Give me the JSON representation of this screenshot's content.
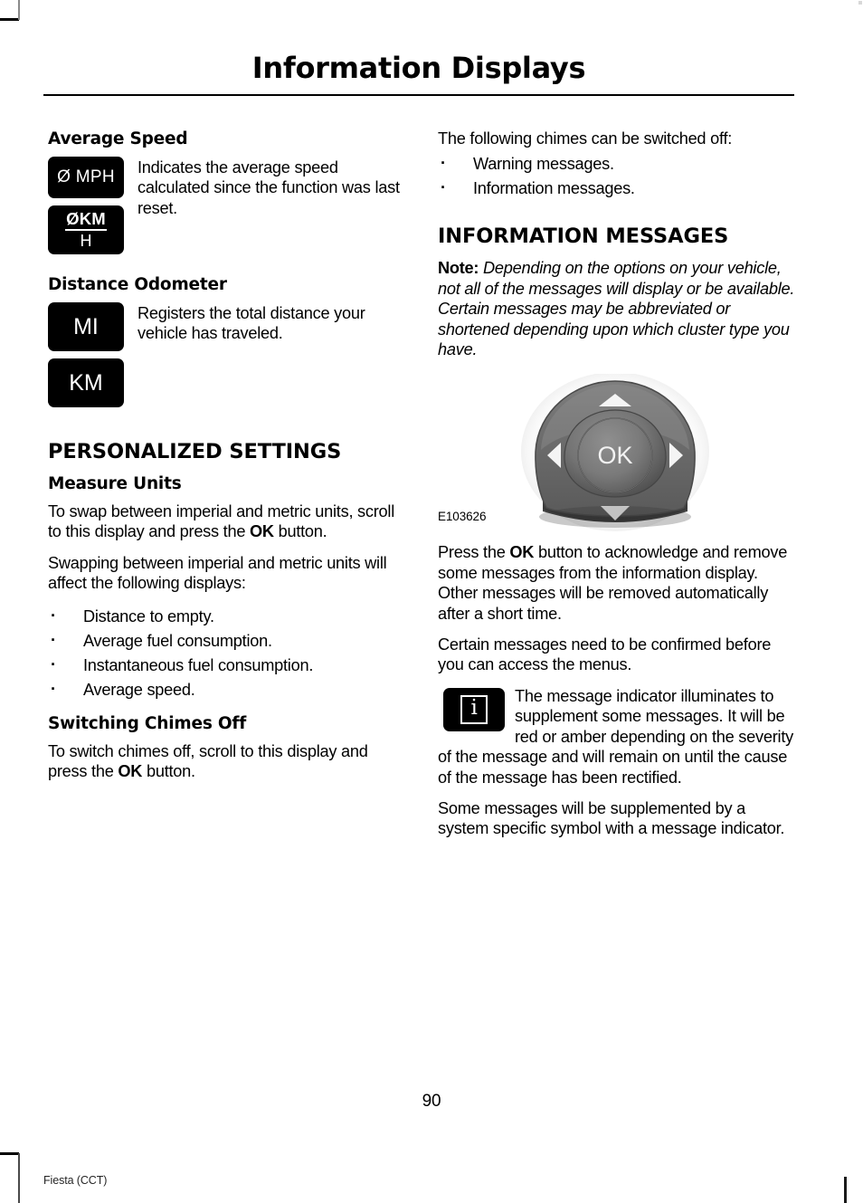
{
  "page": {
    "title": "Information Displays",
    "page_number": "90",
    "footer_left": "Fiesta (CCT)"
  },
  "left_column": {
    "average_speed": {
      "heading": "Average Speed",
      "icons": [
        {
          "name": "avg-speed-mph-icon",
          "label": "Ø MPH"
        },
        {
          "name": "avg-speed-kmh-icon",
          "numerator": "ØKM",
          "denominator": "H"
        }
      ],
      "description": "Indicates the average speed calculated since the function was last reset."
    },
    "distance_odometer": {
      "heading": "Distance Odometer",
      "icons": [
        {
          "name": "odometer-mi-icon",
          "label": "MI"
        },
        {
          "name": "odometer-km-icon",
          "label": "KM"
        }
      ],
      "description": "Registers the total distance your vehicle has traveled."
    },
    "personalized_settings": {
      "heading": "PERSONALIZED SETTINGS",
      "measure_units": {
        "heading": "Measure Units",
        "para1_before": "To swap between imperial and metric units, scroll to this display and press the ",
        "para1_bold": "OK",
        "para1_after": " button.",
        "para2": "Swapping between imperial and metric units will affect the following displays:",
        "bullets": [
          "Distance to empty.",
          "Average fuel consumption.",
          "Instantaneous fuel consumption.",
          "Average speed."
        ]
      },
      "switching_chimes_off": {
        "heading": "Switching Chimes Off",
        "para_before": "To switch chimes off, scroll to this display and press the ",
        "para_bold": "OK",
        "para_after": " button."
      }
    }
  },
  "right_column": {
    "chimes_intro": "The following chimes can be switched off:",
    "chimes_bullets": [
      "Warning messages.",
      "Information messages."
    ],
    "information_messages": {
      "heading": "INFORMATION MESSAGES",
      "note_label": "Note:",
      "note_text": " Depending on the options on your vehicle, not all of the messages will display or be available. Certain messages may be abbreviated or shortened depending upon which cluster type you have.",
      "figure": {
        "caption": "E103626",
        "center_label": "OK",
        "description": "five-way steering wheel control pad with up, down, left and right arrow buttons around a central OK button"
      },
      "para1_before": "Press the ",
      "para1_bold": "OK",
      "para1_after": " button to acknowledge and remove some messages from the information display. Other messages will be removed automatically after a short time.",
      "para2": "Certain messages need to be confirmed before you can access the menus.",
      "indicator_icon": {
        "name": "message-indicator-icon",
        "glyph": "i"
      },
      "para3": "The message indicator illuminates to supplement some messages. It will be red or amber depending on the severity of the message and will remain on until the cause of the message has been rectified.",
      "para4": "Some messages will be supplemented by a system specific symbol with a message indicator."
    }
  },
  "colors": {
    "ink": "#000000",
    "paper": "#ffffff",
    "icon_background": "#000000",
    "icon_foreground": "#ffffff"
  }
}
